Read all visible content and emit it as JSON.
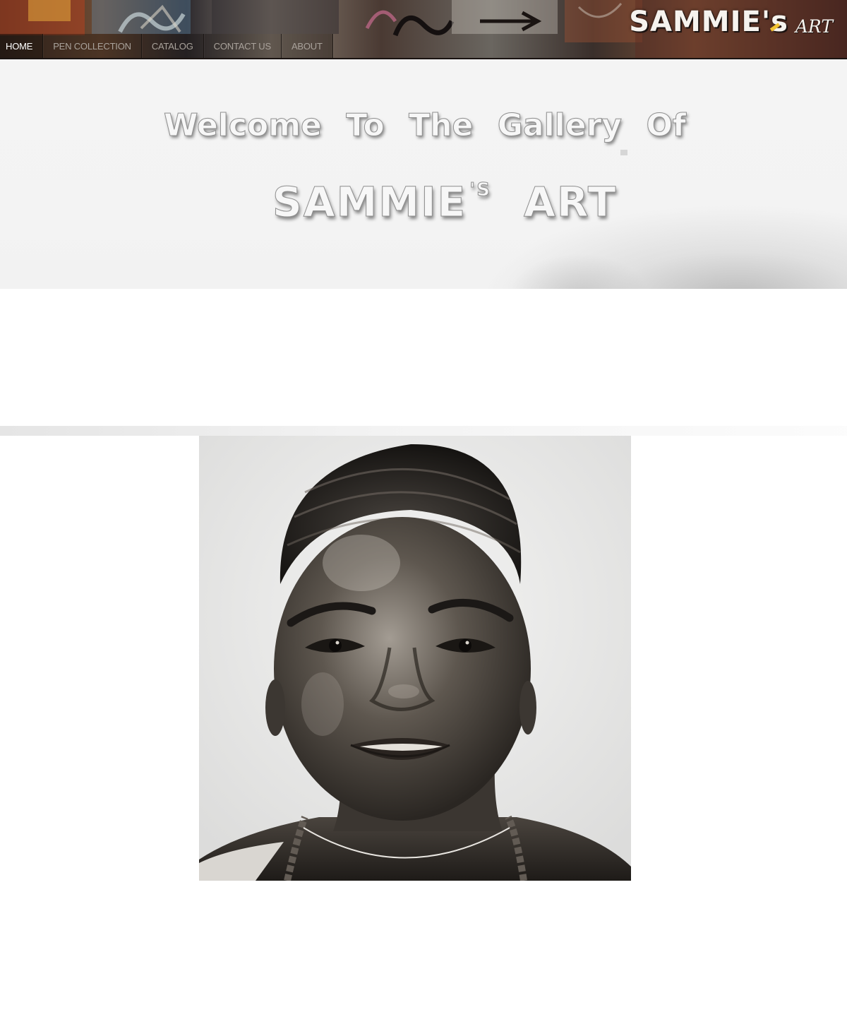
{
  "nav": {
    "items": [
      {
        "label": "HOME",
        "active": true
      },
      {
        "label": "PEN COLLECTION",
        "active": false
      },
      {
        "label": "CATALOG",
        "active": false
      },
      {
        "label": "CONTACT US",
        "active": false
      },
      {
        "label": "ABOUT",
        "active": false
      }
    ]
  },
  "logo": {
    "main": "SAMMIE's",
    "sub": "ART"
  },
  "hero": {
    "welcome_words": [
      "Welcome",
      "To",
      "The",
      "Gallery",
      "Of"
    ],
    "name_main": "SAMMIE",
    "name_sup": "'S",
    "name_end": "ART"
  },
  "colors": {
    "hero_bg": "#f3f3f3",
    "nav_text": "#a9a29b",
    "nav_active": "#ffffff"
  }
}
